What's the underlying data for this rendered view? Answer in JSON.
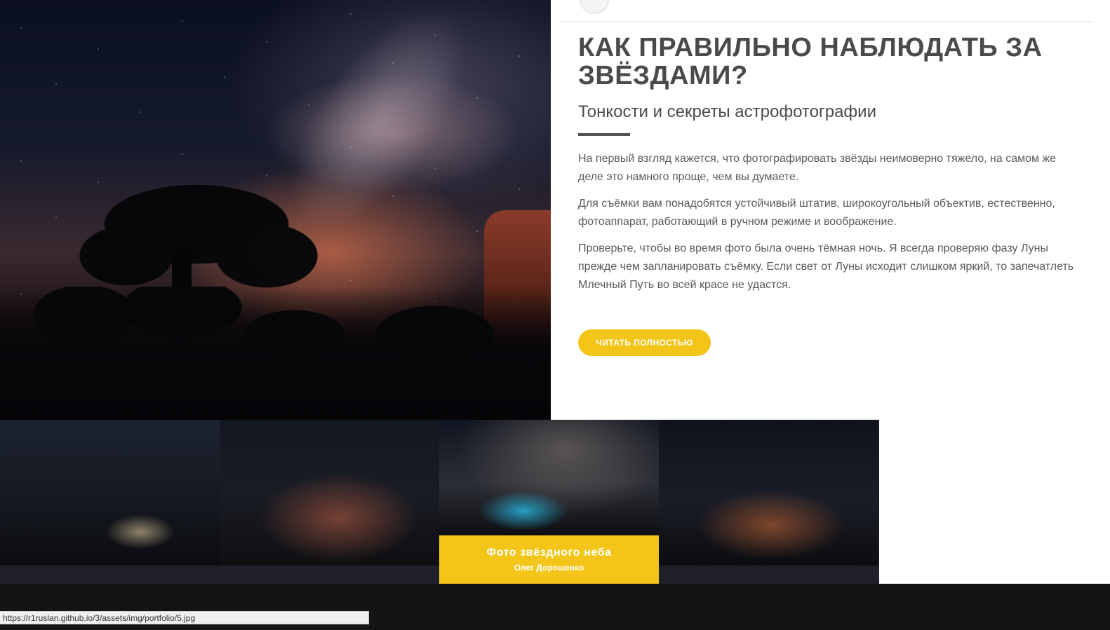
{
  "article": {
    "title": "КАК ПРАВИЛЬНО НАБЛЮДАТЬ ЗА ЗВЁЗДАМИ?",
    "subtitle": "Тонкости и секреты астрофотографии",
    "paragraphs": [
      "На первый взгляд кажется, что фотографировать звёзды неимоверно тяжело, на самом же деле это намного проще, чем вы думаете.",
      "Для съёмки вам понадобятся устойчивый штатив, широкоугольный объектив, естественно, фотоаппарат, работающий в ручном режиме и воображение.",
      "Проверьте, чтобы во время фото была очень тёмная ночь. Я всегда проверяю фазу Луны прежде чем запланировать съёмку. Если свет от Луны исходит слишком яркий, то запечатлеть Млечный Путь во всей красе не удастся."
    ],
    "cta_label": "ЧИТАТЬ ПОЛНОСТЬЮ"
  },
  "portfolio": {
    "active_caption": {
      "title": "Фото звёздного неба",
      "author": "Олег Дорошенко"
    }
  },
  "browser": {
    "status_url": "https://r1ruslan.github.io/3/assets/img/portfolio/5.jpg"
  },
  "colors": {
    "accent": "#f2c518",
    "text": "#4a4a4a",
    "dark": "#141414"
  }
}
